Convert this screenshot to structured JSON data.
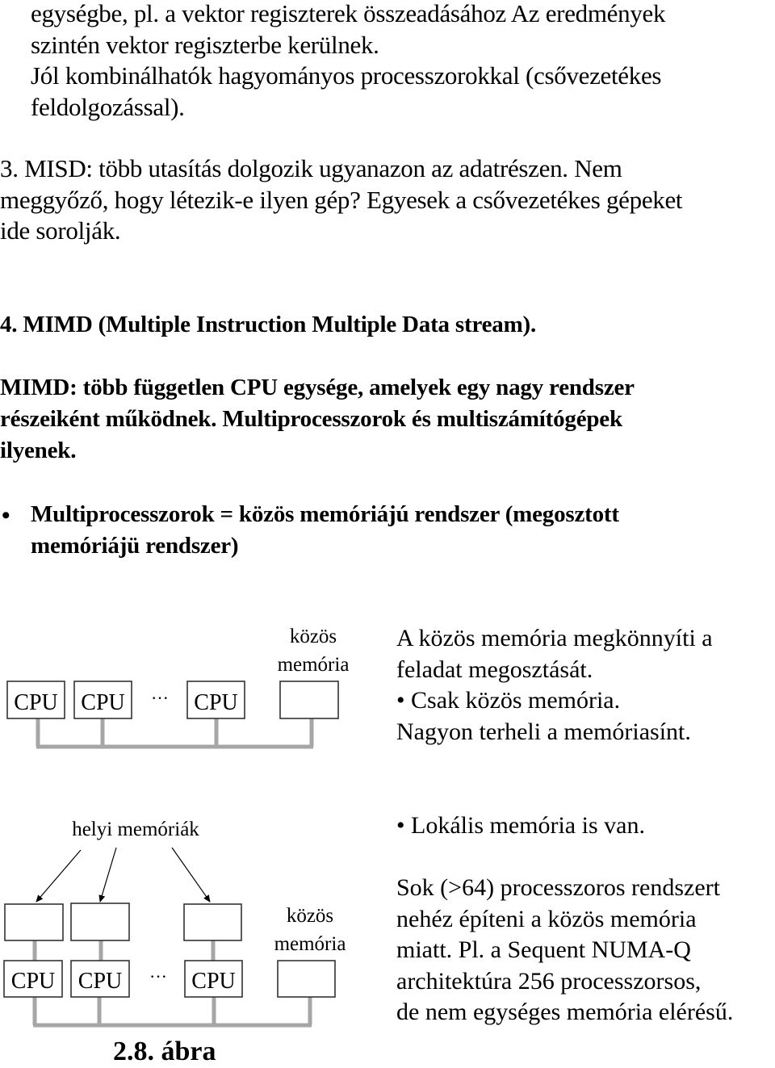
{
  "intro": {
    "lines": [
      "egységbe, pl. a vektor regiszterek összeadásához Az eredmények",
      "szintén vektor regiszterbe kerülnek.",
      "Jól kombinálhatók hagyományos processzorokkal (csővezetékes",
      "feldolgozással)."
    ]
  },
  "misd": {
    "lines": [
      "3. MISD: több utasítás dolgozik ugyanazon az adatrészen. Nem",
      "meggyőző, hogy létezik-e ilyen gép? Egyesek a csővezetékes gépeket",
      "ide sorolják."
    ]
  },
  "mimd": {
    "heading": "4. MIMD (Multiple Instruction Multiple Data stream).",
    "description_lines": [
      "MIMD: több független CPU egysége, amelyek egy nagy rendszer",
      "részeiként működnek. Multiprocesszorok és multiszámítógépek",
      "ilyenek."
    ],
    "bullet": {
      "symbol": "•",
      "lines": [
        "Multiprocesszorok = közös memóriájú rendszer (megosztott",
        "memóriájü rendszer)"
      ]
    }
  },
  "diagram1": {
    "cpu_label": "CPU",
    "ellipsis": "···",
    "shared_memory_label": [
      "közös",
      "memória"
    ],
    "notes": [
      "A közös memória megkönnyíti a",
      "feladat megosztását.",
      "• Csak közös memória.",
      "Nagyon terheli a memóriasínt."
    ]
  },
  "diagram2": {
    "local_memory_label": "helyi memóriák",
    "cpu_label": "CPU",
    "ellipsis": "···",
    "shared_memory_label": [
      "közös",
      "memória"
    ],
    "notes_top": "• Lokális memória is van.",
    "notes": [
      "Sok (>64) processzoros rendszert",
      "nehéz építeni a közös memória",
      "miatt. Pl. a Sequent NUMA-Q",
      "architektúra 256 processzorsos,",
      "de nem egységes memória elérésű."
    ],
    "caption": "2.8. ábra"
  },
  "colors": {
    "text": "#000000",
    "box_border": "#333333",
    "bus": "#a6a6a6"
  }
}
